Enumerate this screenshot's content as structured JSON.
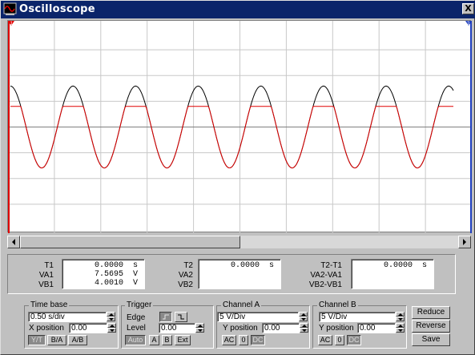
{
  "window": {
    "title": "Oscilloscope",
    "close_label": "X"
  },
  "cursors": {
    "cursor1_label": "1",
    "cursor2_label": "2"
  },
  "readout": {
    "t1_label": "T1",
    "va1_label": "VA1",
    "vb1_label": "VB1",
    "t1_value": "0.0000  s",
    "va1_value": "7.5695  V",
    "vb1_value": "4.0010  V",
    "t2_label": "T2",
    "va2_label": "VA2",
    "vb2_label": "VB2",
    "t2_value": "0.0000  s",
    "dt_label": "T2-T1",
    "dva_label": "VA2-VA1",
    "dvb_label": "VB2-VB1",
    "dt_value": "0.0000  s"
  },
  "timebase": {
    "title": "Time base",
    "scale": "0.50 s/div",
    "xpos_label": "X position",
    "xpos_value": "0.00",
    "modes": [
      "Y/T",
      "B/A",
      "A/B"
    ]
  },
  "trigger": {
    "title": "Trigger",
    "edge_label": "Edge",
    "level_label": "Level",
    "level_value": "0.00",
    "sources": [
      "Auto",
      "A",
      "B",
      "Ext"
    ]
  },
  "channel_a": {
    "title": "Channel A",
    "scale": "5  V/Div",
    "ypos_label": "Y position",
    "ypos_value": "0.00",
    "coupling": [
      "AC",
      "0",
      "DC"
    ]
  },
  "channel_b": {
    "title": "Channel B",
    "scale": "5  V/Div",
    "ypos_label": "Y position",
    "ypos_value": "0.00",
    "coupling": [
      "AC",
      "0",
      "DC"
    ]
  },
  "actions": {
    "reduce": "Reduce",
    "reverse": "Reverse",
    "save": "Save"
  },
  "colors": {
    "trace_a": "#000000",
    "trace_b": "#e00000",
    "grid": "#c8c8c8",
    "axis": "#808080",
    "cursor1": "#e00000",
    "cursor2": "#2040c0"
  },
  "chart_data": {
    "type": "line",
    "x_range_div": [
      0,
      10
    ],
    "y_range_div": [
      -4,
      4
    ],
    "series": [
      {
        "trace": "A",
        "color": "#000000",
        "period_div": 1.35,
        "amplitude_div": 1.59,
        "clip_div": null
      },
      {
        "trace": "B",
        "color": "#e00000",
        "period_div": 1.35,
        "amplitude_div": 1.59,
        "clip_div": 0.8
      }
    ]
  }
}
